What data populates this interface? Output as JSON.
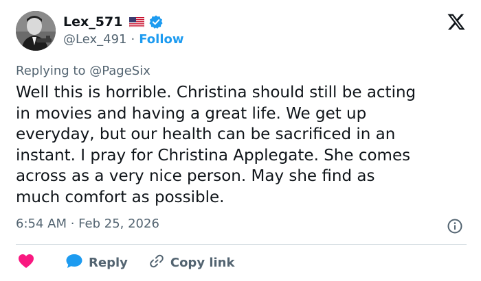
{
  "author": {
    "display_name": "Lex_571",
    "handle": "@Lex_491",
    "separator": "·",
    "follow_label": "Follow",
    "flag_icon": "us-flag-icon",
    "verified_icon": "verified-badge-icon"
  },
  "reply_context": "Replying to @PageSix",
  "tweet": {
    "text": "Well this is horrible. Christina should still be acting\nin movies and having a great life. We get up\neveryday, but our health can be sacrificed in an\ninstant. I pray for Christina Applegate. She comes\nacross as a very nice person. May she find as\nmuch comfort as possible.",
    "timestamp": "6:54 AM · Feb 25, 2026"
  },
  "actions": {
    "like_icon": "heart-icon",
    "reply_label": "Reply",
    "copy_label": "Copy link"
  },
  "colors": {
    "accent": "#1d9bf0",
    "heart": "#f91880",
    "muted": "#536471",
    "text": "#0f1419"
  }
}
